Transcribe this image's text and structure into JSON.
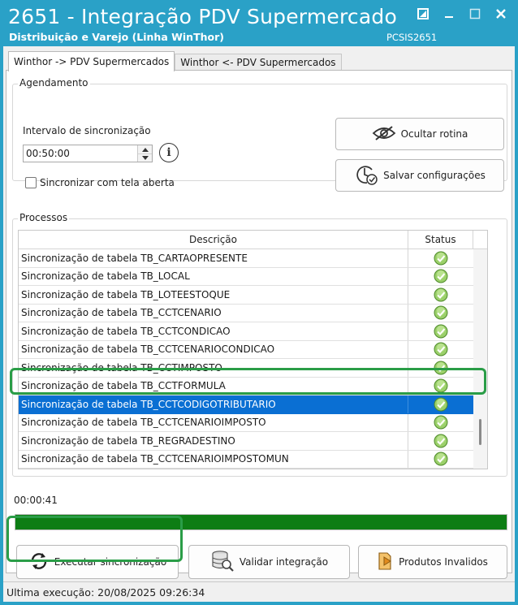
{
  "window": {
    "title": "2651 - Integração PDV Supermercado",
    "subtitle": "Distribuição e Varejo (Linha WinThor)",
    "code": "PCSIS2651",
    "accent_color": "#2aa1c7"
  },
  "tabs": [
    {
      "label": "Winthor -> PDV Supermercados",
      "active": true
    },
    {
      "label": "Winthor <- PDV Supermercados",
      "active": false
    }
  ],
  "agendamento": {
    "legend": "Agendamento",
    "interval_label": "Intervalo de sincronização",
    "interval_value": "00:50:00",
    "sync_open_label": "Sincronizar com tela aberta",
    "sync_open_checked": false,
    "hide_button": "Ocultar rotina",
    "save_button": "Salvar configurações"
  },
  "processos": {
    "legend": "Processos",
    "col_desc": "Descrição",
    "col_status": "Status",
    "rows": [
      {
        "desc": "Sincronização de tabela TB_CARTAOPRESENTE",
        "status": "ok"
      },
      {
        "desc": "Sincronização de tabela TB_LOCAL",
        "status": "ok"
      },
      {
        "desc": "Sincronização de tabela TB_LOTEESTOQUE",
        "status": "ok"
      },
      {
        "desc": "Sincronização de tabela TB_CCTCENARIO",
        "status": "ok"
      },
      {
        "desc": "Sincronização de tabela TB_CCTCONDICAO",
        "status": "ok"
      },
      {
        "desc": "Sincronização de tabela TB_CCTCENARIOCONDICAO",
        "status": "ok"
      },
      {
        "desc": "Sincronização de tabela TB_CCTIMPOSTO",
        "status": "ok"
      },
      {
        "desc": "Sincronização de tabela TB_CCTFORMULA",
        "status": "ok"
      },
      {
        "desc": "Sincronização de tabela TB_CCTCODIGOTRIBUTARIO",
        "status": "ok",
        "selected": true
      },
      {
        "desc": "Sincronização de tabela TB_CCTCENARIOIMPOSTO",
        "status": "ok"
      },
      {
        "desc": "Sincronização de tabela TB_REGRADESTINO",
        "status": "ok"
      },
      {
        "desc": "Sincronização de tabela TB_CCTCENARIOIMPOSTOMUN",
        "status": "ok"
      }
    ]
  },
  "elapsed": "00:00:41",
  "progress_fraction": 1.0,
  "progress_color": "#0d7d14",
  "actions": {
    "execute": "Executar sincronização",
    "validate": "Validar integração",
    "invalid_products": "Produtos Invalidos"
  },
  "status_bar": {
    "text": "Ultima execução: 20/08/2025 09:26:34"
  },
  "highlight_color": "#2a9d47"
}
